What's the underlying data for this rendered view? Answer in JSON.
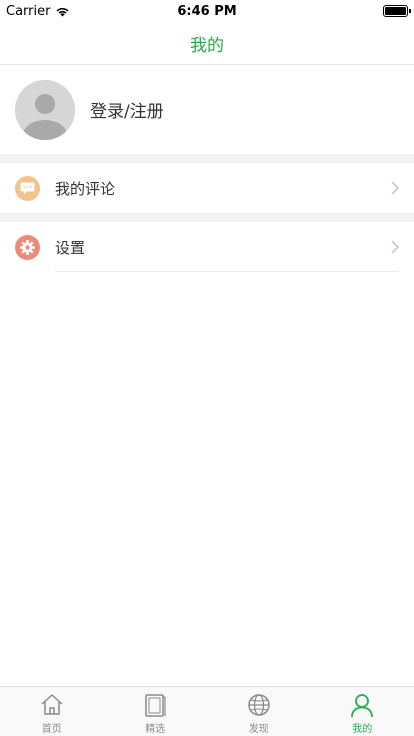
{
  "status_bar": {
    "carrier": "Carrier",
    "time": "6:46 PM"
  },
  "nav": {
    "title": "我的"
  },
  "profile": {
    "login_label": "登录/注册"
  },
  "menu": [
    {
      "label": "我的评论",
      "icon": "comment-icon",
      "icon_color": "#f2c28f"
    },
    {
      "label": "设置",
      "icon": "gear-icon",
      "icon_color": "#ef8a7a"
    }
  ],
  "tab_bar": {
    "tabs": [
      {
        "label": "首页",
        "icon": "home-icon"
      },
      {
        "label": "精选",
        "icon": "book-icon"
      },
      {
        "label": "发现",
        "icon": "globe-icon"
      },
      {
        "label": "我的",
        "icon": "person-icon",
        "active": true
      }
    ]
  },
  "colors": {
    "accent": "#2aa84a",
    "tab_active": "#22b14c",
    "tab_inactive": "#8a8a8a"
  }
}
